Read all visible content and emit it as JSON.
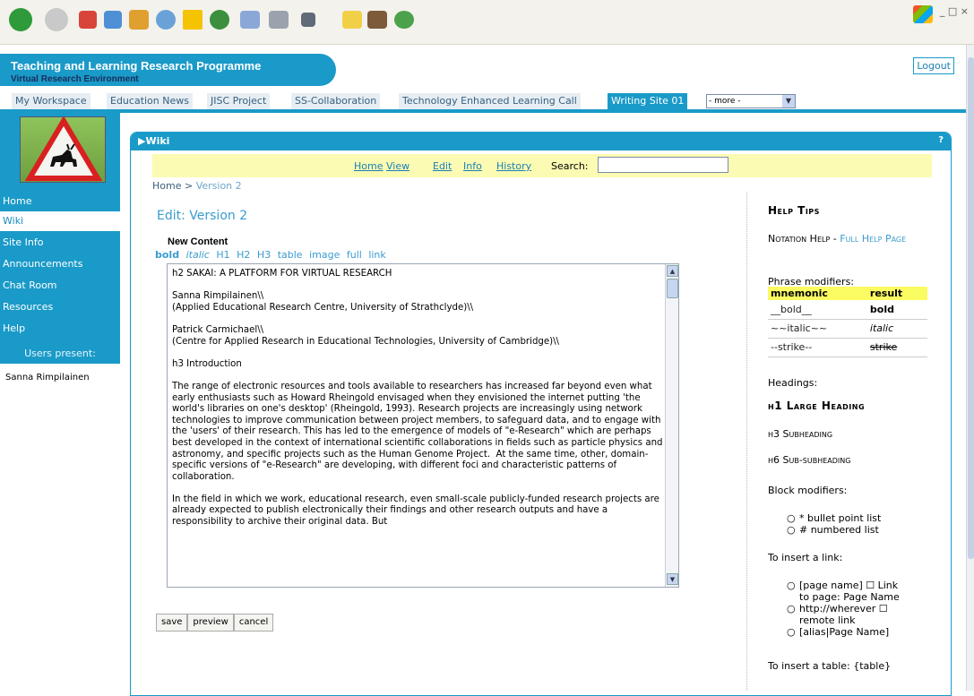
{
  "site": {
    "title": "Teaching and Learning Research Programme",
    "subtitle": "Virtual Research Environment",
    "logout": "Logout"
  },
  "tabs": [
    "My Workspace",
    "Education News",
    "JISC Project",
    "SS-Collaboration",
    "Technology Enhanced Learning Call",
    "Writing Site 01"
  ],
  "tab_more": "- more -",
  "nav": {
    "items": [
      "Home",
      "Wiki",
      "Site Info",
      "Announcements",
      "Chat Room",
      "Resources",
      "Help"
    ],
    "current": "Wiki",
    "users_present_label": "Users present:",
    "users": [
      "Sanna Rimpilainen"
    ]
  },
  "portlet": {
    "title": "▶Wiki",
    "help": "?"
  },
  "wiki_toolbar": {
    "links": [
      "Home",
      "View",
      "Edit",
      "Info",
      "History"
    ],
    "search_label": "Search:",
    "search_value": ""
  },
  "breadcrumb": {
    "home": "Home",
    "separator": ">",
    "current": "Version 2"
  },
  "page_heading": "Edit: Version 2",
  "editor": {
    "label": "New Content",
    "markup_links": [
      "bold",
      "italic",
      "H1",
      "H2",
      "H3",
      "table",
      "image",
      "full",
      "link"
    ],
    "content": "h2 SAKAI: A PLATFORM FOR VIRTUAL RESEARCH\n\nSanna Rimpilainen\\\\\n(Applied Educational Research Centre, University of Strathclyde)\\\\\n\nPatrick Carmichael\\\\\n(Centre for Applied Research in Educational Technologies, University of Cambridge)\\\\\n\nh3 Introduction\n\nThe range of electronic resources and tools available to researchers has increased far beyond even what early enthusiasts such as Howard Rheingold envisaged when they envisioned the internet putting 'the world's libraries on one's desktop' (Rheingold, 1993). Research projects are increasingly using network technologies to improve communication between project members, to safeguard data, and to engage with the 'users' of their research. This has led to the emergence of models of \"e-Research\" which are perhaps best developed in the context of international scientific collaborations in fields such as particle physics and astronomy, and specific projects such as the Human Genome Project.  At the same time, other, domain-specific versions of \"e-Research\" are developing, with different foci and characteristic patterns of collaboration.\n\nIn the field in which we work, educational research, even small-scale publicly-funded research projects are already expected to publish electronically their findings and other research outputs and have a responsibility to archive their original data. But",
    "buttons": [
      "save",
      "preview",
      "cancel"
    ]
  },
  "help": {
    "title": "Help Tips",
    "notation_help": "Notation Help - ",
    "full_help_link": "Full Help Page",
    "phrase_label": "Phrase modifiers:",
    "table_headers": [
      "mnemonic",
      "result"
    ],
    "rows": [
      {
        "mnemonic": "__bold__",
        "result": "bold"
      },
      {
        "mnemonic": "~~italic~~",
        "result": "italic"
      },
      {
        "mnemonic": "--strike--",
        "result": "strike"
      }
    ],
    "headings_label": "Headings:",
    "h1": "h1 Large Heading",
    "h3": "h3 Subheading",
    "h6": "h6 Sub-subheading",
    "block_label": "Block modifiers:",
    "block_items": [
      "* bullet point list",
      "# numbered list"
    ],
    "link_label": "To insert a link:",
    "link_items": [
      {
        "line1": "[page name] ☐ Link",
        "line2": "to page: Page Name"
      },
      {
        "line1": "http://wherever ☐",
        "line2": "remote link"
      },
      {
        "line1": "[alias|Page Name]",
        "line2": ""
      }
    ],
    "table_help": "To insert a table: {table}"
  },
  "colors": {
    "accent": "#1a9ac8",
    "toolbar_bg": "#fbfbb3",
    "table_header": "#fbfb62"
  }
}
